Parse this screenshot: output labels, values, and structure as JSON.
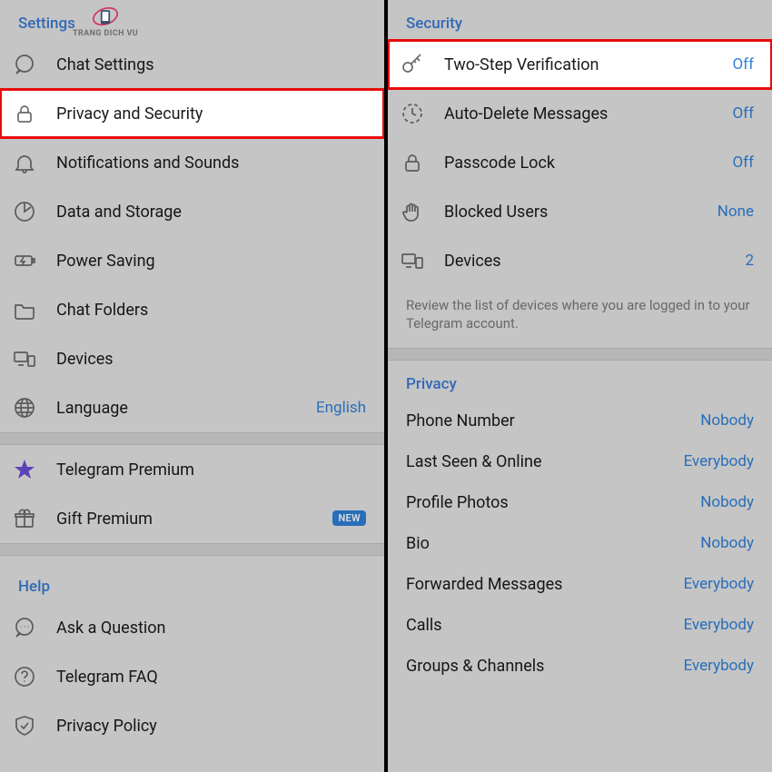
{
  "watermark": {
    "text": "TRANG DICH VU"
  },
  "left": {
    "title": "Settings",
    "items": [
      {
        "icon": "chat",
        "label": "Chat Settings"
      },
      {
        "icon": "lock",
        "label": "Privacy and Security",
        "highlight": true
      },
      {
        "icon": "bell",
        "label": "Notifications and Sounds"
      },
      {
        "icon": "data",
        "label": "Data and Storage"
      },
      {
        "icon": "battery",
        "label": "Power Saving"
      },
      {
        "icon": "folder",
        "label": "Chat Folders"
      },
      {
        "icon": "devices",
        "label": "Devices"
      },
      {
        "icon": "globe",
        "label": "Language",
        "value": "English"
      }
    ],
    "premium": [
      {
        "icon": "star",
        "label": "Telegram Premium"
      },
      {
        "icon": "gift",
        "label": "Gift Premium",
        "badge": "NEW"
      }
    ],
    "helpTitle": "Help",
    "help": [
      {
        "icon": "ask",
        "label": "Ask a Question"
      },
      {
        "icon": "faq",
        "label": "Telegram FAQ"
      },
      {
        "icon": "shield",
        "label": "Privacy Policy"
      }
    ]
  },
  "right": {
    "securityTitle": "Security",
    "security": [
      {
        "icon": "key",
        "label": "Two-Step Verification",
        "value": "Off",
        "highlight": true
      },
      {
        "icon": "timer",
        "label": "Auto-Delete Messages",
        "value": "Off"
      },
      {
        "icon": "lock",
        "label": "Passcode Lock",
        "value": "Off"
      },
      {
        "icon": "hand",
        "label": "Blocked Users",
        "value": "None"
      },
      {
        "icon": "devices",
        "label": "Devices",
        "value": "2"
      }
    ],
    "securityHint": "Review the list of devices where you are logged in to your Telegram account.",
    "privacyTitle": "Privacy",
    "privacy": [
      {
        "label": "Phone Number",
        "value": "Nobody"
      },
      {
        "label": "Last Seen & Online",
        "value": "Everybody"
      },
      {
        "label": "Profile Photos",
        "value": "Nobody"
      },
      {
        "label": "Bio",
        "value": "Nobody"
      },
      {
        "label": "Forwarded Messages",
        "value": "Everybody"
      },
      {
        "label": "Calls",
        "value": "Everybody"
      },
      {
        "label": "Groups & Channels",
        "value": "Everybody"
      }
    ]
  }
}
